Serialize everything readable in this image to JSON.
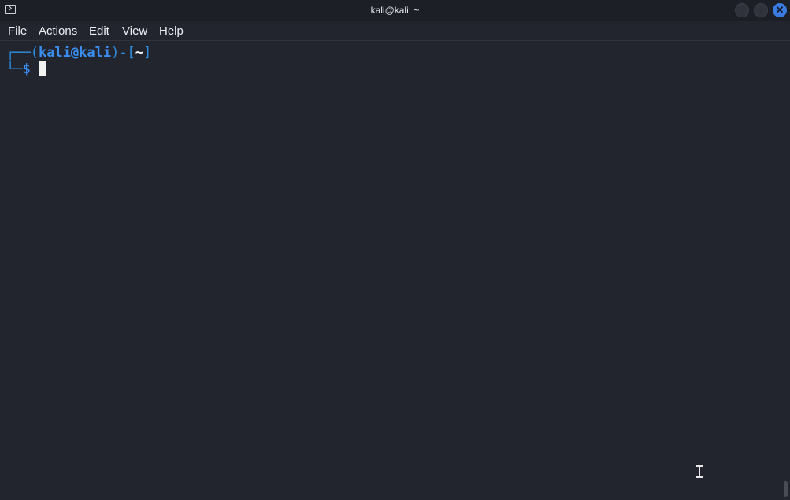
{
  "window": {
    "title": "kali@kali: ~",
    "icon": "terminal-icon",
    "controls": {
      "minimize": "minimize-icon",
      "maximize": "maximize-icon",
      "close": "close-icon",
      "close_glyph": "✕",
      "close_color": "#3a7be0"
    }
  },
  "menu": {
    "items": [
      {
        "label": "File"
      },
      {
        "label": "Actions"
      },
      {
        "label": "Edit"
      },
      {
        "label": "View"
      },
      {
        "label": "Help"
      }
    ]
  },
  "terminal": {
    "prompt": {
      "frame_top": "┌──(",
      "user_host": "kali@kali",
      "frame_mid": ")-[",
      "directory": "~",
      "frame_end": "]",
      "frame_bottom": "└─",
      "symbol": "$"
    },
    "colors": {
      "background": "#23252e",
      "frame": "#2f8fe0",
      "user_host": "#3a8ef0",
      "directory": "#ffffff"
    },
    "mouse_pointer": "text-cursor-icon"
  }
}
